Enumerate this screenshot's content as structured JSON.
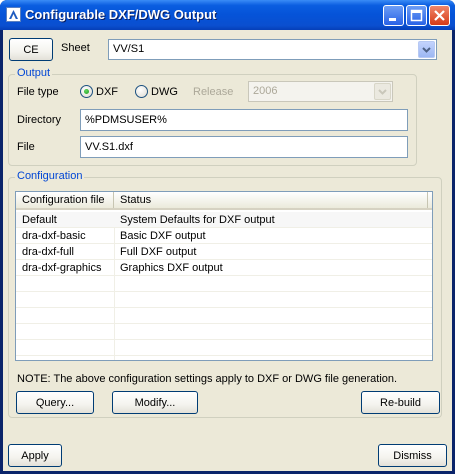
{
  "window": {
    "title": "Configurable DXF/DWG Output"
  },
  "top": {
    "ce_button": "CE",
    "sheet_label": "Sheet",
    "sheet_value": "VV/S1"
  },
  "output": {
    "group_title": "Output",
    "file_type_label": "File type",
    "dxf_label": "DXF",
    "dwg_label": "DWG",
    "selected_type": "DXF",
    "release_label": "Release",
    "release_value": "2006",
    "directory_label": "Directory",
    "directory_value": "%PDMSUSER%",
    "file_label": "File",
    "file_value": "VV.S1.dxf"
  },
  "configuration": {
    "group_title": "Configuration",
    "columns": [
      "Configuration file",
      "Status"
    ],
    "rows": [
      {
        "file": "Default",
        "status": "System Defaults for DXF output"
      },
      {
        "file": "dra-dxf-basic",
        "status": "Basic DXF output"
      },
      {
        "file": "dra-dxf-full",
        "status": "Full DXF output"
      },
      {
        "file": "dra-dxf-graphics",
        "status": "Graphics DXF output"
      }
    ],
    "note": "NOTE: The above configuration settings apply to DXF or DWG file generation.",
    "query_button": "Query...",
    "modify_button": "Modify...",
    "rebuild_button": "Re-build"
  },
  "footer": {
    "apply_button": "Apply",
    "dismiss_button": "Dismiss"
  }
}
